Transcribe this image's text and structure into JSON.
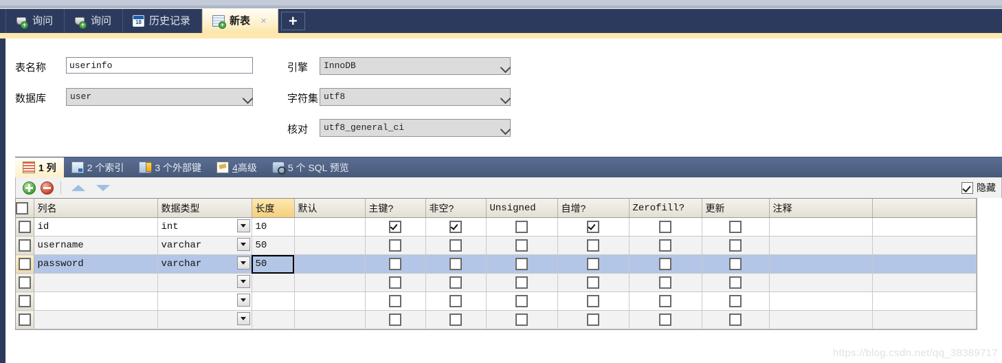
{
  "window": {
    "accent_dark": "#2c3b5d",
    "accent_cream": "#fde8b0",
    "selection_blue": "#b3c6e7"
  },
  "tabbar": {
    "tabs": [
      {
        "label": "询问",
        "icon": "query-icon",
        "active": false,
        "closable": false
      },
      {
        "label": "询问",
        "icon": "query-icon",
        "active": false,
        "closable": false
      },
      {
        "label": "历史记录",
        "icon": "calendar-icon",
        "active": false,
        "closable": false
      },
      {
        "label": "新表",
        "icon": "new-table-icon",
        "active": true,
        "closable": true
      }
    ],
    "close_glyph": "×",
    "new_tab_glyph": "+"
  },
  "form": {
    "table_name_label": "表名称",
    "table_name_value": "userinfo",
    "database_label": "数据库",
    "database_value": "user",
    "engine_label": "引擎",
    "engine_value": "InnoDB",
    "charset_label": "字符集",
    "charset_value": "utf8",
    "collation_label": "核对",
    "collation_value": "utf8_general_ci"
  },
  "inner_tabs": [
    {
      "label": "1 列",
      "icon": "columns-icon",
      "active": true
    },
    {
      "label": "2 个索引",
      "icon": "index-icon",
      "active": false
    },
    {
      "label": "3 个外部键",
      "icon": "foreign-key-icon",
      "active": false
    },
    {
      "label": "4高级",
      "icon": "advanced-icon",
      "active": false,
      "underline_first": true
    },
    {
      "label": "5 个 SQL 预览",
      "icon": "sql-preview-icon",
      "active": false
    }
  ],
  "toolbar": {
    "add_label": "添加栏位",
    "remove_label": "删除栏位",
    "move_up_label": "上移",
    "move_down_label": "下移",
    "hide_checkbox_label": "隐藏",
    "hide_checkbox_checked": true
  },
  "grid": {
    "headers": [
      {
        "text": "列名",
        "highlight": false,
        "mono": false
      },
      {
        "text": "数据类型",
        "highlight": false,
        "mono": false
      },
      {
        "text": "长度",
        "highlight": true,
        "mono": false
      },
      {
        "text": "默认",
        "highlight": false,
        "mono": false
      },
      {
        "text": "主键?",
        "highlight": false,
        "mono": false
      },
      {
        "text": "非空?",
        "highlight": false,
        "mono": false
      },
      {
        "text": "Unsigned",
        "highlight": false,
        "mono": true
      },
      {
        "text": "自增?",
        "highlight": false,
        "mono": false
      },
      {
        "text": "Zerofill?",
        "highlight": false,
        "mono": true
      },
      {
        "text": "更新",
        "highlight": false,
        "mono": false
      },
      {
        "text": "注释",
        "highlight": false,
        "mono": false
      }
    ],
    "rows": [
      {
        "name": "id",
        "type": "int",
        "length": "10",
        "default": "",
        "primary": true,
        "notnull": true,
        "unsigned": false,
        "autoinc": true,
        "zerofill": false,
        "update": "",
        "comment": "",
        "selected": false,
        "alt": false,
        "focus_length": false
      },
      {
        "name": "username",
        "type": "varchar",
        "length": "50",
        "default": "",
        "primary": false,
        "notnull": false,
        "unsigned": false,
        "autoinc": false,
        "zerofill": false,
        "update": "",
        "comment": "",
        "selected": false,
        "alt": true,
        "focus_length": false
      },
      {
        "name": "password",
        "type": "varchar",
        "length": "50",
        "default": "",
        "primary": false,
        "notnull": false,
        "unsigned": false,
        "autoinc": false,
        "zerofill": false,
        "update": "",
        "comment": "",
        "selected": true,
        "alt": false,
        "focus_length": true
      },
      {
        "name": "",
        "type": "",
        "length": "",
        "default": "",
        "primary": false,
        "notnull": false,
        "unsigned": false,
        "autoinc": false,
        "zerofill": false,
        "update": "",
        "comment": "",
        "selected": false,
        "alt": true,
        "focus_length": false
      },
      {
        "name": "",
        "type": "",
        "length": "",
        "default": "",
        "primary": false,
        "notnull": false,
        "unsigned": false,
        "autoinc": false,
        "zerofill": false,
        "update": "",
        "comment": "",
        "selected": false,
        "alt": false,
        "focus_length": false
      },
      {
        "name": "",
        "type": "",
        "length": "",
        "default": "",
        "primary": false,
        "notnull": false,
        "unsigned": false,
        "autoinc": false,
        "zerofill": false,
        "update": "",
        "comment": "",
        "selected": false,
        "alt": true,
        "focus_length": false
      }
    ]
  },
  "watermark": "https://blog.csdn.net/qq_38389717"
}
